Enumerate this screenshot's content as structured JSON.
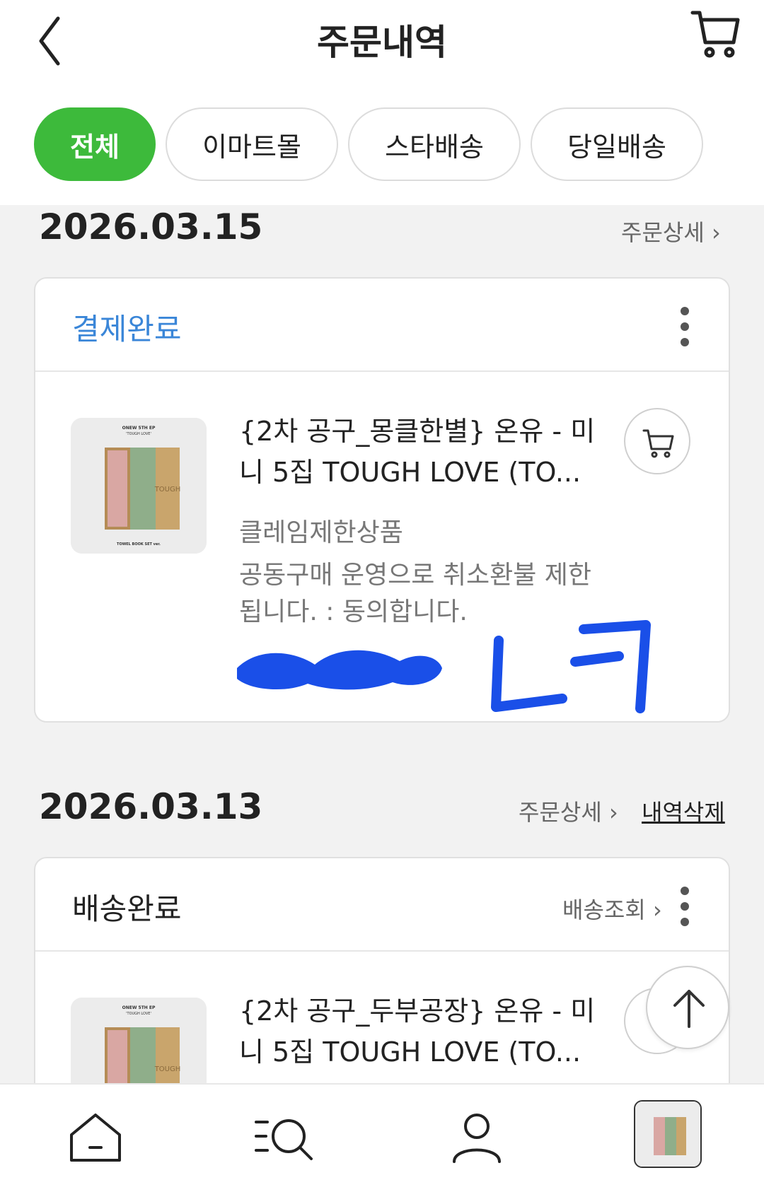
{
  "header": {
    "title": "주문내역",
    "back_icon": "chevron-left-icon",
    "cart_icon": "cart-icon"
  },
  "tabs": [
    {
      "label": "전체",
      "active": true
    },
    {
      "label": "이마트몰",
      "active": false
    },
    {
      "label": "스타배송",
      "active": false
    },
    {
      "label": "당일배송",
      "active": false
    }
  ],
  "orders": [
    {
      "date": "2026.03.15",
      "detail_label": "주문상세",
      "status": "결제완료",
      "status_color": "#3a86d8",
      "product": {
        "name": "{2차 공구_몽클한별} 온유 - 미니 5집 TOUGH LOVE (TO...",
        "claim_text": "클레임제한상품",
        "notice_text": "공동구매 운영으로 취소환불 제한됩니다. : 동의합니다."
      }
    },
    {
      "date": "2026.03.13",
      "detail_label": "주문상세",
      "delete_label": "내역삭제",
      "status": "배송완료",
      "status_color": "#222222",
      "track_label": "배송조회",
      "product": {
        "name": "{2차 공구_두부공장} 온유 - 미니 5집 TOUGH LOVE (TO..."
      }
    }
  ],
  "thumbnail": {
    "top_text": "ONEW 5TH EP",
    "sub_text": "'TOUGH LOVE'",
    "box_text": "TOUGH",
    "bottom_text": "TOWEL BOOK SET ver."
  },
  "bottom_nav": {
    "items": [
      "home-icon",
      "menu-search-icon",
      "user-icon",
      "recent-product-thumbnail"
    ]
  },
  "colors": {
    "accent_green": "#3dba3b",
    "status_blue": "#3a86d8",
    "redaction_blue": "#1a4fe8"
  }
}
